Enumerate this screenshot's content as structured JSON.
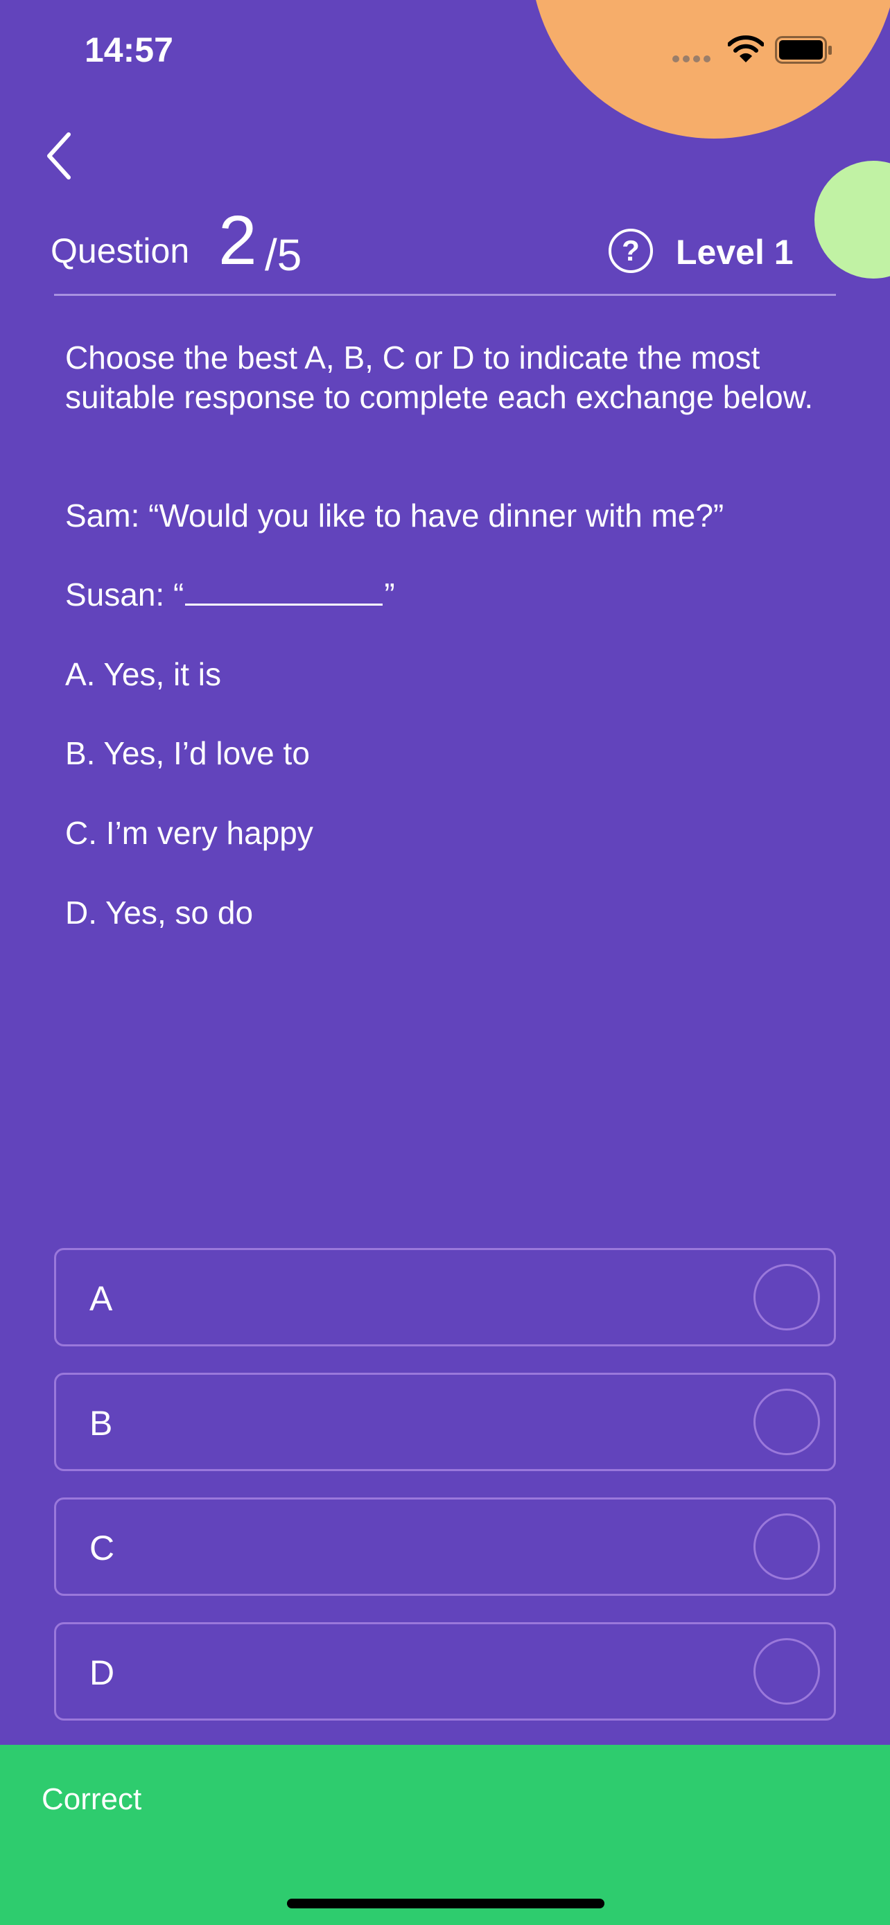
{
  "status_bar": {
    "time": "14:57"
  },
  "header": {
    "question_label": "Question",
    "question_number": "2",
    "question_total": "/5",
    "help_symbol": "?",
    "level_label": "Level 1"
  },
  "question": {
    "instruction": "Choose the best A, B, C or D to indicate the most suitable response to complete each exchange below.",
    "line_sam": "Sam: “Would you like to have dinner with me?”",
    "susan_prefix": "Susan: “",
    "susan_suffix": "”",
    "options": [
      "A. Yes, it is",
      "B. Yes, I’d love to",
      "C. I’m very happy",
      "D. Yes, so do"
    ]
  },
  "answers": [
    "A",
    "B",
    "C",
    "D"
  ],
  "footer": {
    "label": "Correct"
  },
  "colors": {
    "background": "#6244BC",
    "accent_orange": "#F6AD6A",
    "accent_green": "#C1F2A4",
    "footer_green": "#2ECC6E",
    "border": "#9A78DB"
  },
  "icons": {
    "back": "chevron-left-icon",
    "help": "question-circle-icon",
    "wifi": "wifi-icon",
    "battery": "battery-icon",
    "signal": "signal-icon"
  }
}
